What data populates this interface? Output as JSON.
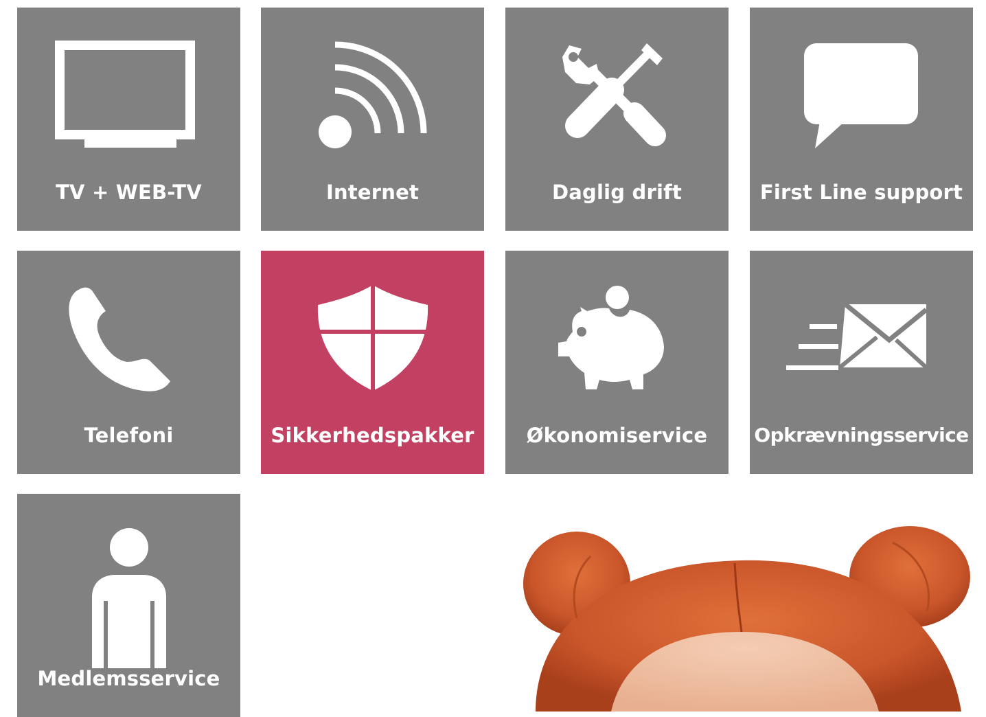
{
  "colors": {
    "tile_default": "#818181",
    "tile_active": "#c24163",
    "label": "#ffffff",
    "background": "#ffffff"
  },
  "tiles": [
    {
      "label": "TV + WEB-TV",
      "icon": "tv-icon",
      "active": false
    },
    {
      "label": "Internet",
      "icon": "wifi-signal-icon",
      "active": false
    },
    {
      "label": "Daglig drift",
      "icon": "tools-icon",
      "active": false
    },
    {
      "label": "First Line support",
      "icon": "chat-bubble-icon",
      "active": false
    },
    {
      "label": "Telefoni",
      "icon": "phone-icon",
      "active": false
    },
    {
      "label": "Sikkerhedspakker",
      "icon": "shield-icon",
      "active": true
    },
    {
      "label": "Økonomiservice",
      "icon": "piggy-bank-icon",
      "active": false
    },
    {
      "label": "Opkrævningsservice",
      "icon": "fast-mail-icon",
      "active": false
    },
    {
      "label": "Medlemsservice",
      "icon": "person-icon",
      "active": false
    }
  ]
}
